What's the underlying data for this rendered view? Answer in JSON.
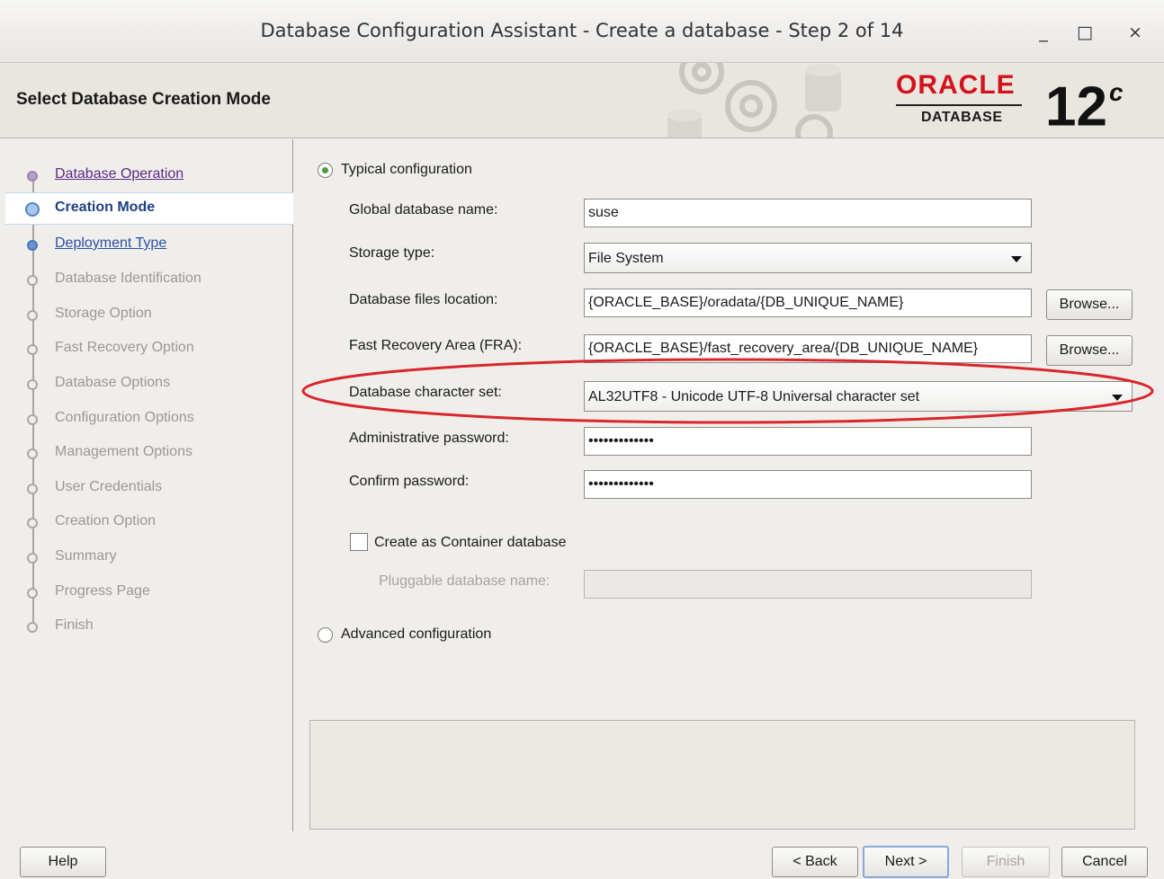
{
  "window": {
    "title": "Database Configuration Assistant - Create a database - Step 2 of 14",
    "minimize": "_",
    "maximize": "□",
    "close": "×"
  },
  "header": {
    "page_title": "Select Database Creation Mode",
    "brand": "ORACLE",
    "brand_sub": "DATABASE",
    "version": "12",
    "version_suffix": "c"
  },
  "steps": [
    {
      "label": "Database Operation",
      "state": "done"
    },
    {
      "label": "Creation Mode",
      "state": "current"
    },
    {
      "label": "Deployment Type",
      "state": "next"
    },
    {
      "label": "Database Identification",
      "state": "future"
    },
    {
      "label": "Storage Option",
      "state": "future"
    },
    {
      "label": "Fast Recovery Option",
      "state": "future"
    },
    {
      "label": "Database Options",
      "state": "future"
    },
    {
      "label": "Configuration Options",
      "state": "future"
    },
    {
      "label": "Management Options",
      "state": "future"
    },
    {
      "label": "User Credentials",
      "state": "future"
    },
    {
      "label": "Creation Option",
      "state": "future"
    },
    {
      "label": "Summary",
      "state": "future"
    },
    {
      "label": "Progress Page",
      "state": "future"
    },
    {
      "label": "Finish",
      "state": "future"
    }
  ],
  "form": {
    "typical_label": "Typical configuration",
    "global_db_name_label": "Global database name:",
    "global_db_name_value": "suse",
    "storage_type_label": "Storage type:",
    "storage_type_value": "File System",
    "db_files_location_label": "Database files location:",
    "db_files_location_value": "{ORACLE_BASE}/oradata/{DB_UNIQUE_NAME}",
    "fra_label": "Fast Recovery Area (FRA):",
    "fra_value": "{ORACLE_BASE}/fast_recovery_area/{DB_UNIQUE_NAME}",
    "browse_label": "Browse...",
    "charset_label": "Database character set:",
    "charset_value": "AL32UTF8 - Unicode UTF-8 Universal character set",
    "admin_password_label": "Administrative password:",
    "admin_password_value": "•••••••••••••",
    "confirm_password_label": "Confirm password:",
    "confirm_password_value": "•••••••••••••",
    "container_label": "Create as Container database",
    "pluggable_label": "Pluggable database name:",
    "pluggable_value": "",
    "advanced_label": "Advanced configuration"
  },
  "footer": {
    "help": "Help",
    "back": "< Back",
    "next": "Next >",
    "finish": "Finish",
    "cancel": "Cancel"
  },
  "colors": {
    "annotation": "#d9262c",
    "oracle_red": "#d4121b"
  }
}
